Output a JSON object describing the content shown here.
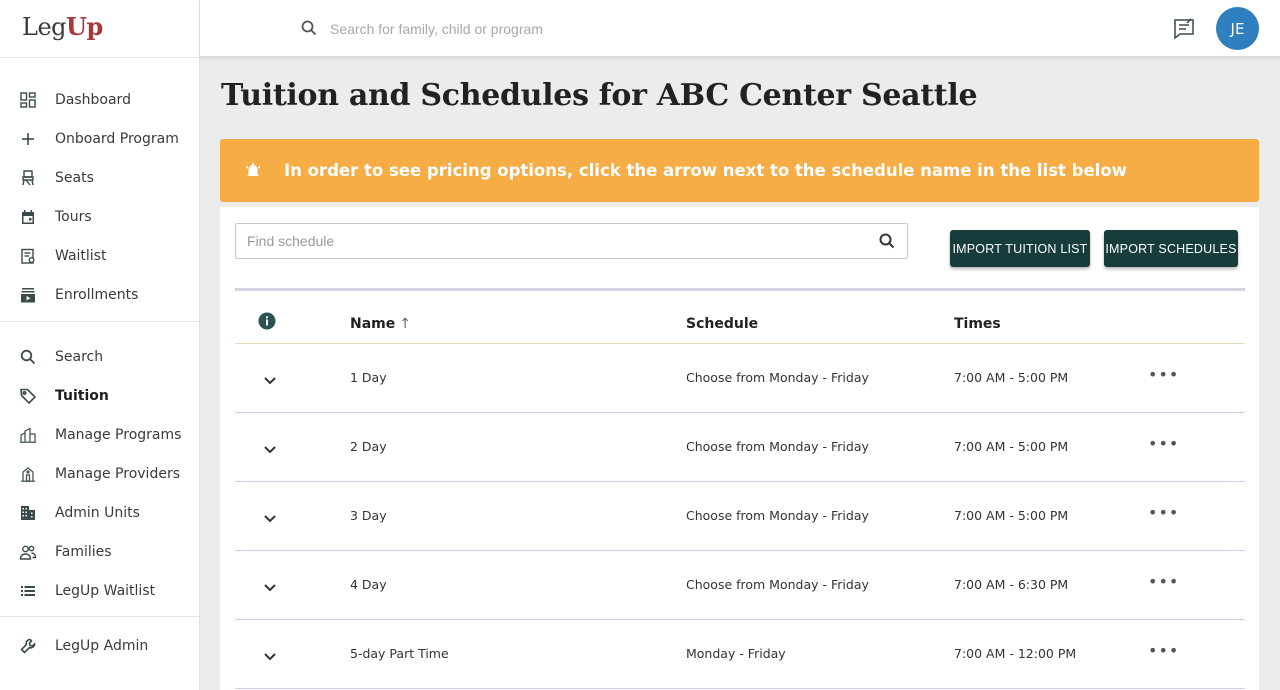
{
  "logo": {
    "leg": "Leg",
    "up": "Up"
  },
  "sidebar": {
    "primary": [
      {
        "label": "Dashboard",
        "icon": "dashboard-icon"
      },
      {
        "label": "Onboard Program",
        "icon": "plus-icon"
      },
      {
        "label": "Seats",
        "icon": "seat-icon"
      },
      {
        "label": "Tours",
        "icon": "calendar-icon"
      },
      {
        "label": "Waitlist",
        "icon": "clipboard-icon"
      },
      {
        "label": "Enrollments",
        "icon": "enrollment-icon"
      }
    ],
    "secondary": [
      {
        "label": "Search",
        "icon": "search-icon"
      },
      {
        "label": "Tuition",
        "icon": "tag-icon",
        "active": true
      },
      {
        "label": "Manage Programs",
        "icon": "building-icon"
      },
      {
        "label": "Manage Providers",
        "icon": "provider-icon"
      },
      {
        "label": "Admin Units",
        "icon": "office-icon"
      },
      {
        "label": "Families",
        "icon": "people-icon"
      },
      {
        "label": "LegUp Waitlist",
        "icon": "list-icon"
      }
    ],
    "admin": [
      {
        "label": "LegUp Admin",
        "icon": "wrench-icon"
      }
    ]
  },
  "topbar": {
    "search_placeholder": "Search for family, child or program",
    "avatar_initials": "JE"
  },
  "page": {
    "title": "Tuition and Schedules for ABC Center Seattle",
    "alert": "In order to see pricing options, click the arrow next to the schedule name in the list below"
  },
  "toolbar": {
    "find_placeholder": "Find schedule",
    "import_tuition_label": "IMPORT TUITION LIST",
    "import_schedules_label": "IMPORT SCHEDULES"
  },
  "table": {
    "headers": {
      "name": "Name",
      "schedule": "Schedule",
      "times": "Times"
    },
    "rows": [
      {
        "name": "1 Day",
        "schedule": "Choose from Monday - Friday",
        "times": "7:00 AM - 5:00 PM"
      },
      {
        "name": "2 Day",
        "schedule": "Choose from Monday - Friday",
        "times": "7:00 AM - 5:00 PM"
      },
      {
        "name": "3 Day",
        "schedule": "Choose from Monday - Friday",
        "times": "7:00 AM - 5:00 PM"
      },
      {
        "name": "4 Day",
        "schedule": "Choose from Monday - Friday",
        "times": "7:00 AM - 6:30 PM"
      },
      {
        "name": "5-day Part Time",
        "schedule": "Monday - Friday",
        "times": "7:00 AM - 12:00 PM"
      }
    ]
  },
  "colors": {
    "alert_bg": "#f6ad45",
    "button_bg": "#163c3c",
    "avatar_bg": "#2f7fbf",
    "logo_accent": "#a8373c"
  }
}
